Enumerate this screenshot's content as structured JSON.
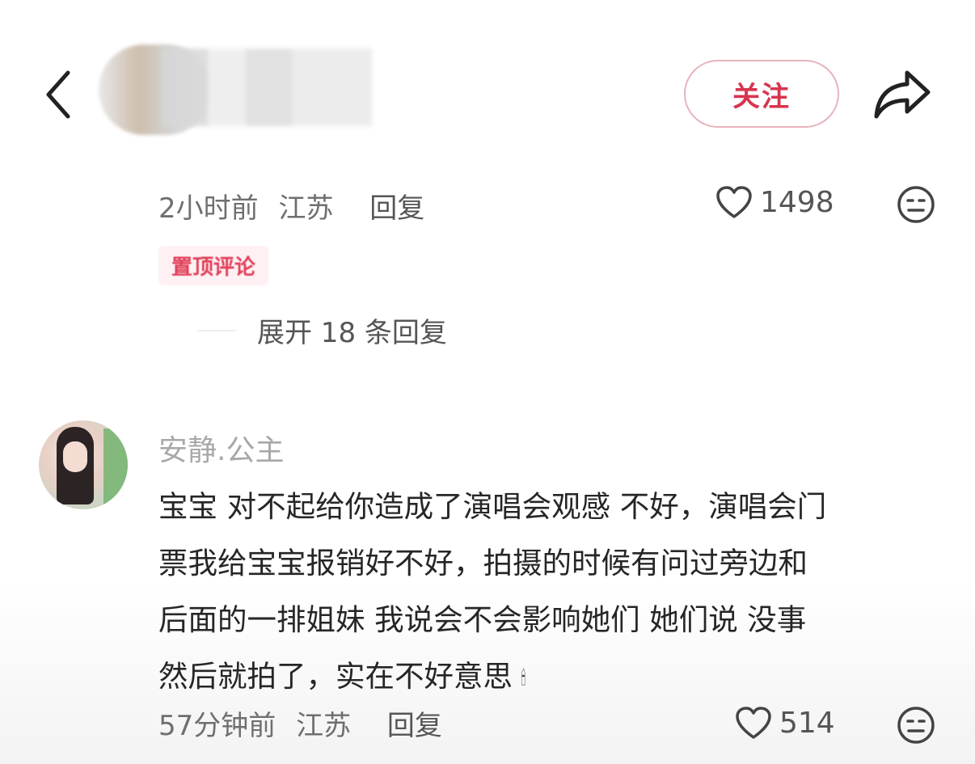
{
  "header": {
    "follow_label": "关注"
  },
  "comments": [
    {
      "time": "2小时前",
      "location": "江苏",
      "reply_label": "回复",
      "likes": "1498",
      "pinned_label": "置顶评论",
      "expand_label": "展开 18 条回复"
    },
    {
      "username": "安静.公主",
      "body_lines": [
        "宝宝 对不起给你造成了演唱会观感 不好，演唱会门",
        "票我给宝宝报销好不好，拍摄的时候有问过旁边和",
        "后面的一排姐妹 我说会不会影响她们 她们说 没事",
        "然后就拍了，实在不好意思"
      ],
      "emoji": "🕯",
      "time": "57分钟前",
      "location": "江苏",
      "reply_label": "回复",
      "likes": "514"
    }
  ],
  "icons": {
    "back": "chevron-left-icon",
    "share": "share-arrow-icon",
    "like": "heart-outline-icon",
    "dislike": "neutral-face-icon"
  },
  "colors": {
    "accent": "#d8344f",
    "follow_border": "#e8b3bc",
    "pinned_bg": "#fff1f3",
    "meta_text": "#6f6f6f",
    "username": "#a8a8a8"
  }
}
